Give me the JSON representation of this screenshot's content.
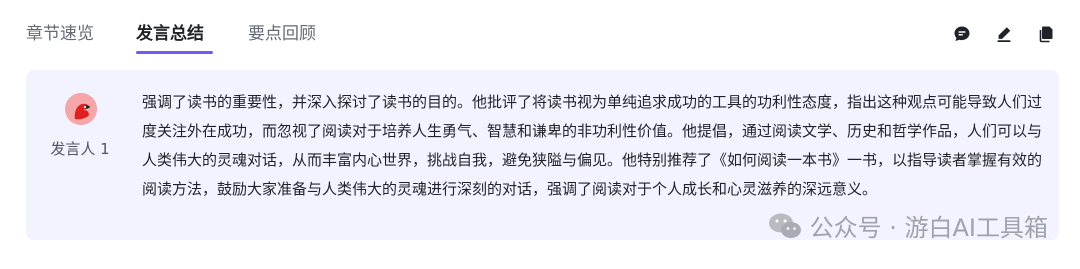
{
  "tabs": [
    {
      "label": "章节速览"
    },
    {
      "label": "发言总结"
    },
    {
      "label": "要点回顾"
    }
  ],
  "actions": {
    "comment_icon": "chat-bubble-icon",
    "edit_icon": "edit-pencil-icon",
    "copy_icon": "copy-icon"
  },
  "card": {
    "speaker": "发言人 1",
    "summary": "强调了读书的重要性，并深入探讨了读书的目的。他批评了将读书视为单纯追求成功的工具的功利性态度，指出这种观点可能导致人们过度关注外在成功，而忽视了阅读对于培养人生勇气、智慧和谦卑的非功利性价值。他提倡，通过阅读文学、历史和哲学作品，人们可以与人类伟大的灵魂对话，从而丰富内心世界，挑战自我，避免狭隘与偏见。他特别推荐了《如何阅读一本书》一书，以指导读者掌握有效的阅读方法，鼓励大家准备与人类伟大的灵魂进行深刻的对话，强调了阅读对于个人成长和心灵滋养的深远意义。"
  },
  "watermark": {
    "text": "公众号 · 游白AI工具箱"
  },
  "colors": {
    "accent": "#6b5cf6",
    "card_bg": "#f2f3fe",
    "avatar_bg": "#f4a6a8"
  }
}
